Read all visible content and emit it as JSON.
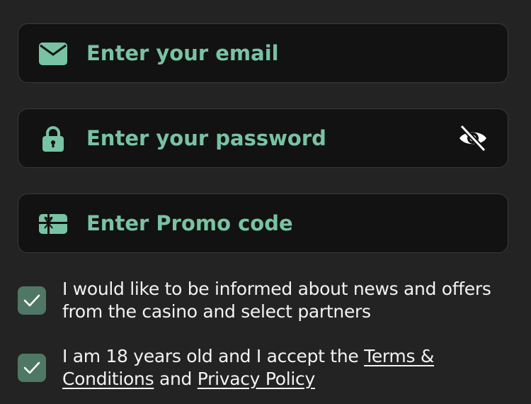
{
  "form": {
    "email": {
      "value": "",
      "placeholder": "Enter your email",
      "icon": "envelope-icon"
    },
    "password": {
      "value": "",
      "placeholder": "Enter your password",
      "icon": "lock-icon",
      "toggle_icon": "eye-slash-icon"
    },
    "promo": {
      "value": "",
      "placeholder": "Enter Promo code",
      "icon": "gift-card-icon"
    }
  },
  "consents": {
    "news": {
      "checked": true,
      "label": "I would like to be informed about news and offers from the casino and select partners"
    },
    "terms": {
      "checked": true,
      "label_prefix": "I am 18 years old and I accept the ",
      "terms_link": "Terms & Conditions",
      "label_middle": " and ",
      "privacy_link": "Privacy Policy"
    }
  },
  "colors": {
    "background": "#232323",
    "field_background": "#121212",
    "accent": "#78c3a3",
    "checkbox": "#4f7766",
    "text": "#f2f2f2"
  }
}
